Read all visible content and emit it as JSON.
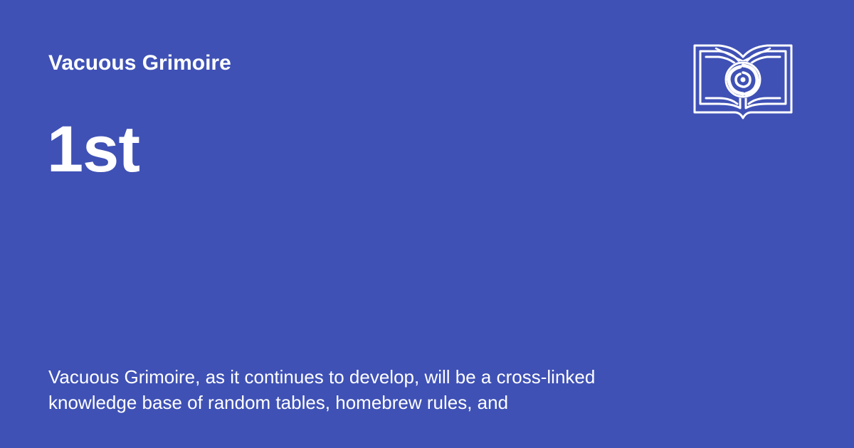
{
  "site": {
    "name": "Vacuous Grimoire"
  },
  "page": {
    "title": "1st",
    "description": "Vacuous Grimoire, as it continues to develop, will be a cross-linked knowledge base of random tables, homebrew rules, and"
  },
  "logo": {
    "icon": "open-book-vortex-icon"
  },
  "colors": {
    "background": "#3f51b5",
    "foreground": "#ffffff"
  }
}
